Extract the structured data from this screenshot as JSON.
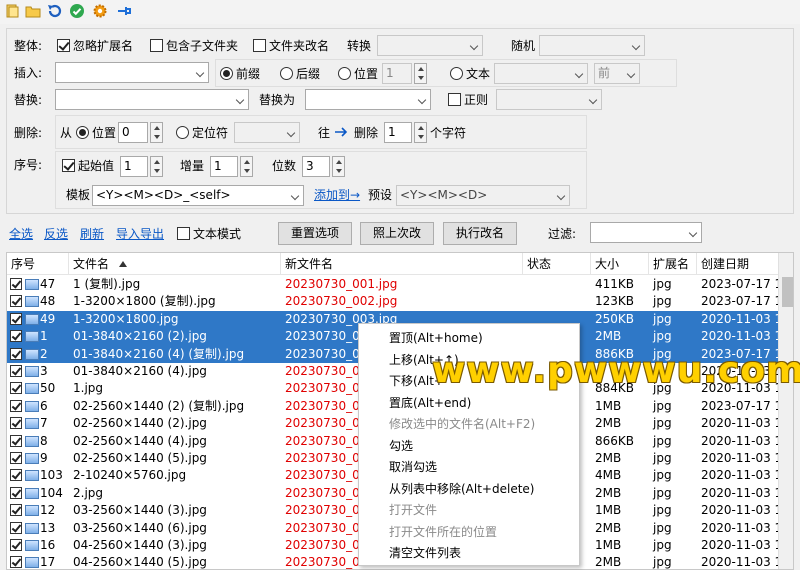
{
  "options": {
    "whole_label": "整体:",
    "ignore_ext": "忽略扩展名",
    "include_sub": "包含子文件夹",
    "folder_rename": "文件夹改名",
    "convert_label": "转换",
    "random_label": "随机",
    "insert_label": "插入:",
    "insert_prefix": "前缀",
    "insert_suffix": "后缀",
    "insert_position": "位置",
    "insert_position_value": "1",
    "insert_text": "文本",
    "insert_text_side": "前",
    "replace_label": "替换:",
    "replace_with_label": "替换为",
    "regex_label": "正则",
    "delete_label": "删除:",
    "delete_from": "从",
    "delete_position": "位置",
    "delete_position_value": "0",
    "delete_locator": "定位符",
    "delete_to": "往",
    "delete_count_label": "删除",
    "delete_count_value": "1",
    "delete_unit": "个字符",
    "seq_label": "序号:",
    "start_label": "起始值",
    "start_value": "1",
    "increment_label": "增量",
    "increment_value": "1",
    "digits_label": "位数",
    "digits_value": "3",
    "template_label": "模板",
    "template_value": "<Y><M><D>_<self>",
    "add_to_link": "添加到→",
    "preset_label": "预设",
    "preset_value": "<Y><M><D>"
  },
  "actions": {
    "select_all": "全选",
    "invert": "反选",
    "refresh": "刷新",
    "import_export": "导入导出",
    "text_mode": "文本模式",
    "reset": "重置选项",
    "same_as_last": "照上次改",
    "execute": "执行改名",
    "filter_label": "过滤:"
  },
  "table": {
    "headers": [
      "序号",
      "文件名",
      "新文件名",
      "状态",
      "大小",
      "扩展名",
      "创建日期"
    ],
    "rows": [
      {
        "no": "47",
        "name": "1 (复制).jpg",
        "new": "20230730_001.jpg",
        "size": "411KB",
        "ext": "jpg",
        "date": "2023-07-17 1",
        "sel": false
      },
      {
        "no": "48",
        "name": "1-3200×1800 (复制).jpg",
        "new": "20230730_002.jpg",
        "size": "123KB",
        "ext": "jpg",
        "date": "2023-07-17 1",
        "sel": false
      },
      {
        "no": "49",
        "name": "1-3200×1800.jpg",
        "new": "20230730_003.jpg",
        "size": "250KB",
        "ext": "jpg",
        "date": "2020-11-03 1",
        "sel": true
      },
      {
        "no": "1",
        "name": "01-3840×2160 (2).jpg",
        "new": "20230730_0",
        "size": "2MB",
        "ext": "jpg",
        "date": "2020-11-03 1",
        "sel": true
      },
      {
        "no": "2",
        "name": "01-3840×2160 (4) (复制).jpg",
        "new": "20230730_0",
        "size": "886KB",
        "ext": "jpg",
        "date": "2023-07-17 1",
        "sel": true
      },
      {
        "no": "3",
        "name": "01-3840×2160 (4).jpg",
        "new": "20230730_0",
        "size": "",
        "ext": "",
        "date": "2020-11-03 1",
        "sel": false
      },
      {
        "no": "50",
        "name": "1.jpg",
        "new": "20230730_0",
        "size": "884KB",
        "ext": "jpg",
        "date": "2020-11-03 1",
        "sel": false
      },
      {
        "no": "6",
        "name": "02-2560×1440 (2) (复制).jpg",
        "new": "20230730_0",
        "size": "1MB",
        "ext": "jpg",
        "date": "2023-07-17 1",
        "sel": false
      },
      {
        "no": "7",
        "name": "02-2560×1440 (2).jpg",
        "new": "20230730_0",
        "size": "2MB",
        "ext": "jpg",
        "date": "2020-11-03 1",
        "sel": false
      },
      {
        "no": "8",
        "name": "02-2560×1440 (4).jpg",
        "new": "20230730_0",
        "size": "866KB",
        "ext": "jpg",
        "date": "2020-11-03 1",
        "sel": false
      },
      {
        "no": "9",
        "name": "02-2560×1440 (5).jpg",
        "new": "20230730_0",
        "size": "2MB",
        "ext": "jpg",
        "date": "2020-11-03 1",
        "sel": false
      },
      {
        "no": "103",
        "name": "2-10240×5760.jpg",
        "new": "20230730_0",
        "size": "4MB",
        "ext": "jpg",
        "date": "2020-11-03 1",
        "sel": false
      },
      {
        "no": "104",
        "name": "2.jpg",
        "new": "20230730_0",
        "size": "2MB",
        "ext": "jpg",
        "date": "2020-11-03 1",
        "sel": false
      },
      {
        "no": "12",
        "name": "03-2560×1440 (3).jpg",
        "new": "20230730_0",
        "size": "1MB",
        "ext": "jpg",
        "date": "2020-11-03 1",
        "sel": false
      },
      {
        "no": "13",
        "name": "03-2560×1440 (6).jpg",
        "new": "20230730_0",
        "size": "2MB",
        "ext": "jpg",
        "date": "2020-11-03 1",
        "sel": false
      },
      {
        "no": "16",
        "name": "04-2560×1440 (3).jpg",
        "new": "20230730_0",
        "size": "1MB",
        "ext": "jpg",
        "date": "2020-11-03 1",
        "sel": false
      },
      {
        "no": "17",
        "name": "04-2560×1440 (5).jpg",
        "new": "20230730_0",
        "size": "2MB",
        "ext": "jpg",
        "date": "2020-11-03 1",
        "sel": false
      }
    ]
  },
  "context_menu": {
    "items": [
      {
        "label": "置顶(Alt+home)",
        "disabled": false
      },
      {
        "label": "上移(Alt+↑)",
        "disabled": false
      },
      {
        "label": "下移(Alt+",
        "disabled": false
      },
      {
        "label": "置底(Alt+end)",
        "disabled": false
      },
      {
        "label": "修改选中的文件名(Alt+F2)",
        "disabled": true
      },
      {
        "label": "勾选",
        "disabled": false
      },
      {
        "label": "取消勾选",
        "disabled": false
      },
      {
        "label": "从列表中移除(Alt+delete)",
        "disabled": false
      },
      {
        "label": "打开文件",
        "disabled": true
      },
      {
        "label": "打开文件所在的位置",
        "disabled": true
      },
      {
        "label": "清空文件列表",
        "disabled": false
      }
    ]
  },
  "watermark": "www.pwwwu.com",
  "colors": {
    "selection": "#2f78c7",
    "new_name": "#e00000",
    "link": "#0b58c6"
  }
}
